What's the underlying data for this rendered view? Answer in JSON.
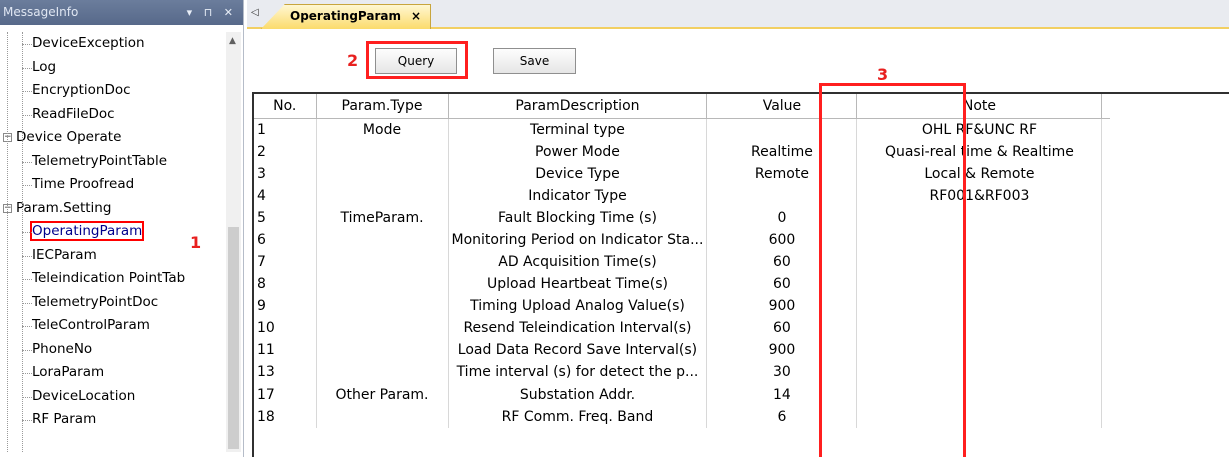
{
  "left_panel": {
    "title": "MessageInfo",
    "controls": "▾ ⊓ ✕",
    "tree_items": [
      {
        "label": "DeviceException",
        "level": "child"
      },
      {
        "label": "Log",
        "level": "child"
      },
      {
        "label": "EncryptionDoc",
        "level": "child"
      },
      {
        "label": "ReadFileDoc",
        "level": "child"
      },
      {
        "label": "Device Operate",
        "level": "group"
      },
      {
        "label": "TelemetryPointTable",
        "level": "child"
      },
      {
        "label": "Time Proofread",
        "level": "child"
      },
      {
        "label": "Param.Setting",
        "level": "group"
      },
      {
        "label": "OperatingParam",
        "level": "child",
        "selected": true
      },
      {
        "label": "IECParam",
        "level": "child"
      },
      {
        "label": "Teleindication PointTab",
        "level": "child"
      },
      {
        "label": "TelemetryPointDoc",
        "level": "child"
      },
      {
        "label": "TeleControlParam",
        "level": "child"
      },
      {
        "label": "PhoneNo",
        "level": "child"
      },
      {
        "label": "LoraParam",
        "level": "child"
      },
      {
        "label": "DeviceLocation",
        "level": "child"
      },
      {
        "label": "RF Param",
        "level": "child"
      }
    ]
  },
  "annotations": {
    "marker1": "1",
    "marker2": "2",
    "marker3": "3",
    "color": "#e8201f"
  },
  "tabs": [
    {
      "label": "OperatingParam",
      "close": "×",
      "active": true
    }
  ],
  "toolbar": {
    "query_label": "Query",
    "save_label": "Save"
  },
  "table": {
    "columns": [
      "No.",
      "Param.Type",
      "ParamDescription",
      "Value",
      "Note"
    ],
    "rows": [
      [
        "1",
        "Mode",
        "Terminal type",
        "",
        "OHL RF&UNC RF"
      ],
      [
        "2",
        "",
        "Power Mode",
        "Realtime",
        "Quasi-real time & Realtime"
      ],
      [
        "3",
        "",
        "Device Type",
        "Remote",
        "Local & Remote"
      ],
      [
        "4",
        "",
        "Indicator Type",
        "",
        "RF001&RF003"
      ],
      [
        "5",
        "TimeParam.",
        "Fault Blocking Time (s)",
        "0",
        ""
      ],
      [
        "6",
        "",
        "Monitoring Period on Indicator Sta...",
        "600",
        ""
      ],
      [
        "7",
        "",
        "AD Acquisition Time(s)",
        "60",
        ""
      ],
      [
        "8",
        "",
        "Upload Heartbeat Time(s)",
        "60",
        ""
      ],
      [
        "9",
        "",
        "Timing Upload Analog Value(s)",
        "900",
        ""
      ],
      [
        "10",
        "",
        "Resend Teleindication Interval(s)",
        "60",
        ""
      ],
      [
        "11",
        "",
        "Load Data Record Save Interval(s)",
        "900",
        ""
      ],
      [
        "13",
        "",
        "Time interval (s) for detect the p...",
        "30",
        ""
      ],
      [
        "17",
        "Other Param.",
        "Substation Addr.",
        "14",
        ""
      ],
      [
        "18",
        "",
        "RF Comm. Freq. Band",
        "6",
        ""
      ]
    ]
  }
}
